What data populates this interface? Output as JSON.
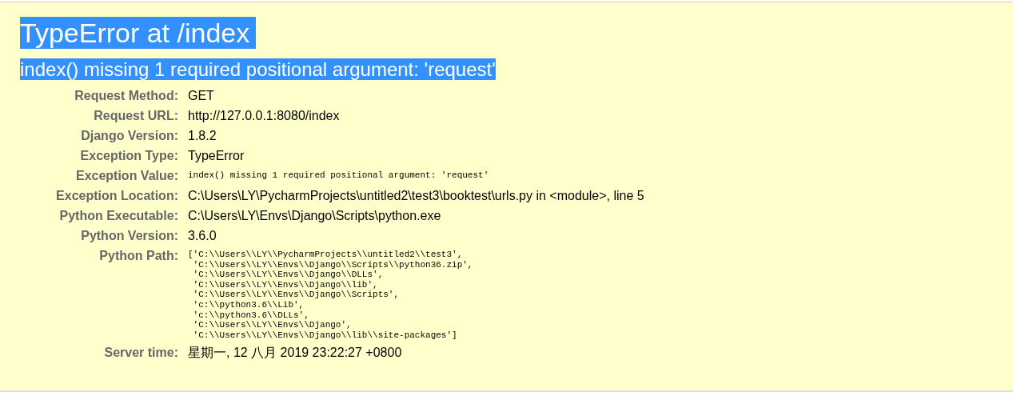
{
  "title": "TypeError at /index",
  "subtitle": "index() missing 1 required positional argument: 'request'",
  "meta": [
    {
      "label": "Request Method:",
      "kind": "text",
      "value": "GET"
    },
    {
      "label": "Request URL:",
      "kind": "text",
      "value": "http://127.0.0.1:8080/index"
    },
    {
      "label": "Django Version:",
      "kind": "text",
      "value": "1.8.2"
    },
    {
      "label": "Exception Type:",
      "kind": "text",
      "value": "TypeError"
    },
    {
      "label": "Exception Value:",
      "kind": "code",
      "value": "index() missing 1 required positional argument: 'request'"
    },
    {
      "label": "Exception Location:",
      "kind": "text",
      "value": "C:\\Users\\LY\\PycharmProjects\\untitled2\\test3\\booktest\\urls.py in <module>, line 5"
    },
    {
      "label": "Python Executable:",
      "kind": "text",
      "value": "C:\\Users\\LY\\Envs\\Django\\Scripts\\python.exe"
    },
    {
      "label": "Python Version:",
      "kind": "text",
      "value": "3.6.0"
    },
    {
      "label": "Python Path:",
      "kind": "lines",
      "lines": [
        "['C:\\\\Users\\\\LY\\\\PycharmProjects\\\\untitled2\\\\test3',",
        " 'C:\\\\Users\\\\LY\\\\Envs\\\\Django\\\\Scripts\\\\python36.zip',",
        " 'C:\\\\Users\\\\LY\\\\Envs\\\\Django\\\\DLLs',",
        " 'C:\\\\Users\\\\LY\\\\Envs\\\\Django\\\\lib',",
        " 'C:\\\\Users\\\\LY\\\\Envs\\\\Django\\\\Scripts',",
        " 'c:\\\\python3.6\\\\Lib',",
        " 'c:\\\\python3.6\\\\DLLs',",
        " 'C:\\\\Users\\\\LY\\\\Envs\\\\Django',",
        " 'C:\\\\Users\\\\LY\\\\Envs\\\\Django\\\\lib\\\\site-packages']"
      ]
    },
    {
      "label": "Server time:",
      "kind": "text",
      "value": "星期一, 12 八月 2019 23:22:27 +0800"
    }
  ]
}
